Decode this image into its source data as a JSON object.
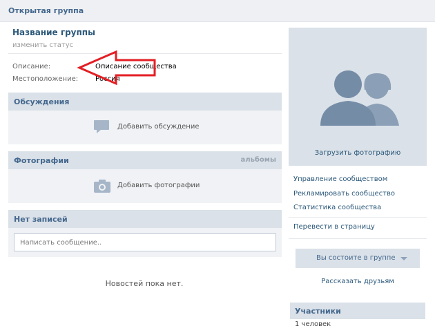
{
  "header": {
    "title": "Открытая группа"
  },
  "group": {
    "name": "Название группы",
    "status_link": "изменить статус",
    "info": [
      {
        "label": "Описание:",
        "value": "Описание сообщества"
      },
      {
        "label": "Местоположение:",
        "value": "Россия"
      }
    ]
  },
  "discussions": {
    "title": "Обсуждения",
    "add_label": "Добавить обсуждение",
    "icon": "comment-icon"
  },
  "photos": {
    "title": "Фотографии",
    "albums_link": "альбомы",
    "add_label": "Добавить фотографии",
    "icon": "camera-icon"
  },
  "wall": {
    "title": "Нет записей",
    "compose_placeholder": "Написать сообщение..",
    "empty_text": "Новостей пока нет."
  },
  "sidebar": {
    "upload_photo": "Загрузить фотографию",
    "menu": [
      "Управление сообществом",
      "Рекламировать сообщество",
      "Статистика сообщества"
    ],
    "convert_link": "Перевести в страницу",
    "member_button": "Вы состоите в группе",
    "tell_friends": "Рассказать друзьям",
    "members_title": "Участники",
    "members_count": "1 человек"
  },
  "colors": {
    "link": "#2b587a",
    "header_bg": "#dae1e8",
    "annotation_arrow": "#e31e24"
  }
}
